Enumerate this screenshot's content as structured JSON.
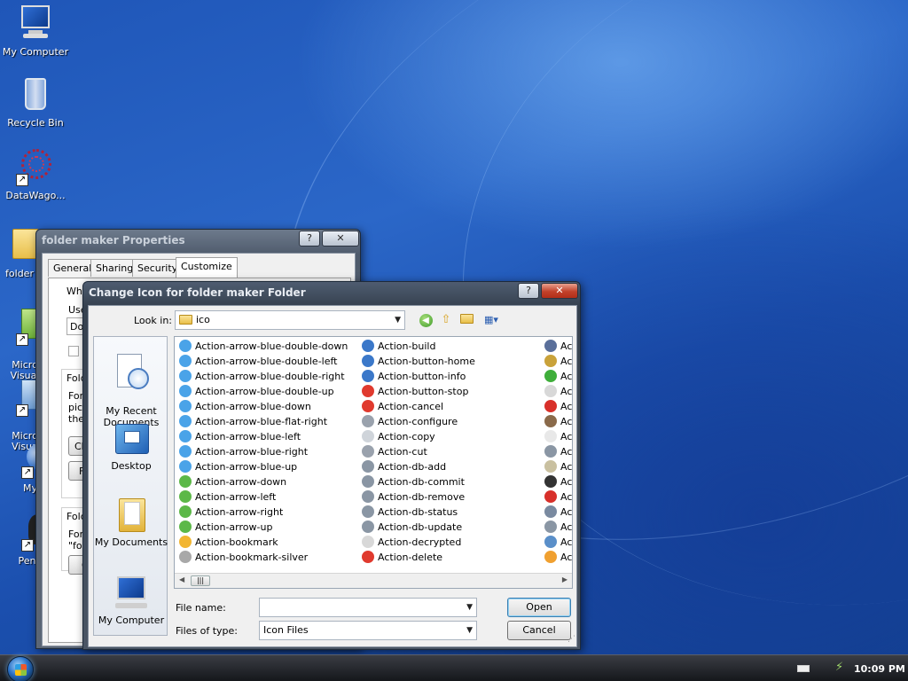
{
  "desktop": {
    "icons": [
      {
        "label": "My Computer"
      },
      {
        "label": "Recycle Bin"
      },
      {
        "label": "DataWago..."
      },
      {
        "label": "folder"
      },
      {
        "label": "Micro\nVisual"
      },
      {
        "label": "Micro\nVisua"
      },
      {
        "label": "My"
      },
      {
        "label": "Peng"
      }
    ]
  },
  "properties": {
    "title": "folder maker Properties",
    "tabs": [
      "General",
      "Sharing",
      "Security",
      "Customize"
    ],
    "active_tab": "Customize",
    "fragments": [
      "What",
      "Use",
      "Do",
      "A",
      "Fold",
      "For",
      "pict",
      "the",
      "Ch",
      "F",
      "Fold",
      "For",
      "\"fol",
      "C"
    ]
  },
  "dialog": {
    "title": "Change Icon for folder maker Folder",
    "look_in_label": "Look in:",
    "look_in_value": "ico",
    "places": [
      "My Recent\nDocuments",
      "Desktop",
      "My Documents",
      "My Computer"
    ],
    "columns": [
      [
        {
          "name": "Action-arrow-blue-double-down",
          "color": "#4aa3e8"
        },
        {
          "name": "Action-arrow-blue-double-left",
          "color": "#4aa3e8"
        },
        {
          "name": "Action-arrow-blue-double-right",
          "color": "#4aa3e8"
        },
        {
          "name": "Action-arrow-blue-double-up",
          "color": "#4aa3e8"
        },
        {
          "name": "Action-arrow-blue-down",
          "color": "#4aa3e8"
        },
        {
          "name": "Action-arrow-blue-flat-right",
          "color": "#4aa3e8"
        },
        {
          "name": "Action-arrow-blue-left",
          "color": "#4aa3e8"
        },
        {
          "name": "Action-arrow-blue-right",
          "color": "#4aa3e8"
        },
        {
          "name": "Action-arrow-blue-up",
          "color": "#4aa3e8"
        },
        {
          "name": "Action-arrow-down",
          "color": "#5cb848"
        },
        {
          "name": "Action-arrow-left",
          "color": "#5cb848"
        },
        {
          "name": "Action-arrow-right",
          "color": "#5cb848"
        },
        {
          "name": "Action-arrow-up",
          "color": "#5cb848"
        },
        {
          "name": "Action-bookmark",
          "color": "#f2b632"
        },
        {
          "name": "Action-bookmark-silver",
          "color": "#a8a8a8"
        }
      ],
      [
        {
          "name": "Action-build",
          "color": "#3b78c9"
        },
        {
          "name": "Action-button-home",
          "color": "#3b78c9"
        },
        {
          "name": "Action-button-info",
          "color": "#3b78c9"
        },
        {
          "name": "Action-button-stop",
          "color": "#e03a2e"
        },
        {
          "name": "Action-cancel",
          "color": "#e03a2e"
        },
        {
          "name": "Action-configure",
          "color": "#9aa2ad"
        },
        {
          "name": "Action-copy",
          "color": "#cfd4da"
        },
        {
          "name": "Action-cut",
          "color": "#9aa2ad"
        },
        {
          "name": "Action-db-add",
          "color": "#8a96a4"
        },
        {
          "name": "Action-db-commit",
          "color": "#8a96a4"
        },
        {
          "name": "Action-db-remove",
          "color": "#8a96a4"
        },
        {
          "name": "Action-db-status",
          "color": "#8a96a4"
        },
        {
          "name": "Action-db-update",
          "color": "#8a96a4"
        },
        {
          "name": "Action-decrypted",
          "color": "#d8d8d8"
        },
        {
          "name": "Action-delete",
          "color": "#e03a2e"
        }
      ],
      [
        {
          "name": "Act",
          "color": "#5a6f9a"
        },
        {
          "name": "Ac",
          "color": "#c9a23a"
        },
        {
          "name": "Ac",
          "color": "#3fae3a"
        },
        {
          "name": "Ac",
          "color": "#d8d8d8"
        },
        {
          "name": "Ac",
          "color": "#d8302a"
        },
        {
          "name": "Ac",
          "color": "#8a6a4a"
        },
        {
          "name": "Ac",
          "color": "#e8e8e8"
        },
        {
          "name": "Ac",
          "color": "#8a96a4"
        },
        {
          "name": "Ac",
          "color": "#c9c0a0"
        },
        {
          "name": "Ac",
          "color": "#333333"
        },
        {
          "name": "Ac",
          "color": "#d8302a"
        },
        {
          "name": "Ac",
          "color": "#7a8aa0"
        },
        {
          "name": "Ac",
          "color": "#8a96a4"
        },
        {
          "name": "Ac",
          "color": "#5a8fc9"
        },
        {
          "name": "Ac",
          "color": "#f0a030"
        }
      ]
    ],
    "file_name_label": "File name:",
    "file_name_value": "",
    "files_of_type_label": "Files of type:",
    "files_of_type_value": "Icon Files",
    "open_label": "Open",
    "cancel_label": "Cancel"
  },
  "taskbar": {
    "clock": "10:09 PM"
  }
}
